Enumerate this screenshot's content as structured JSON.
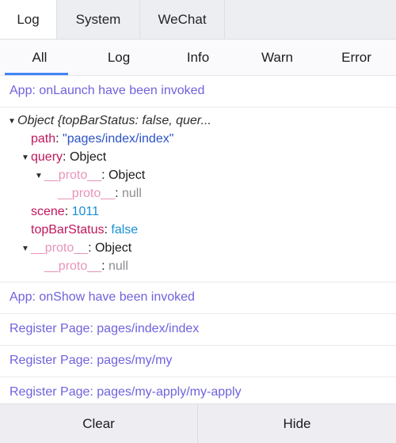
{
  "panel_tabs": {
    "items": [
      {
        "label": "Log",
        "active": true
      },
      {
        "label": "System",
        "active": false
      },
      {
        "label": "WeChat",
        "active": false
      }
    ]
  },
  "filter_tabs": {
    "items": [
      {
        "label": "All",
        "active": true
      },
      {
        "label": "Log",
        "active": false
      },
      {
        "label": "Info",
        "active": false
      },
      {
        "label": "Warn",
        "active": false
      },
      {
        "label": "Error",
        "active": false
      }
    ]
  },
  "log": {
    "entry_1": "App: onLaunch have been invoked",
    "object_block": {
      "header": "Object {topBarStatus: false, quer...",
      "caret_glyph": "▼",
      "rows": [
        {
          "key": "path",
          "colon": ":",
          "value": "\"pages/index/index\""
        },
        {
          "key": "query",
          "colon": ":",
          "value": "Object"
        },
        {
          "key": "__proto__",
          "colon": ":",
          "value": "Object"
        },
        {
          "key": "__proto__",
          "colon": ":",
          "value": "null"
        },
        {
          "key": "scene",
          "colon": ":",
          "value": "1011"
        },
        {
          "key": "topBarStatus",
          "colon": ":",
          "value": "false"
        },
        {
          "key": "__proto__",
          "colon": ":",
          "value": "Object"
        },
        {
          "key": "__proto__",
          "colon": ":",
          "value": "null"
        }
      ]
    },
    "entry_2": "App: onShow have been invoked",
    "entry_3": "Register Page: pages/index/index",
    "entry_4": "Register Page: pages/my/my",
    "entry_5": "Register Page: pages/my-apply/my-apply"
  },
  "bottom_bar": {
    "clear_label": "Clear",
    "hide_label": "Hide"
  },
  "colors": {
    "accent_blue": "#4285f4",
    "log_purple": "#6f62dd",
    "key_crimson": "#c0175c",
    "proto_pink": "#e794ba",
    "string_blue": "#2c52c7",
    "number_blue": "#168fd3",
    "null_gray": "#8a8d91"
  }
}
